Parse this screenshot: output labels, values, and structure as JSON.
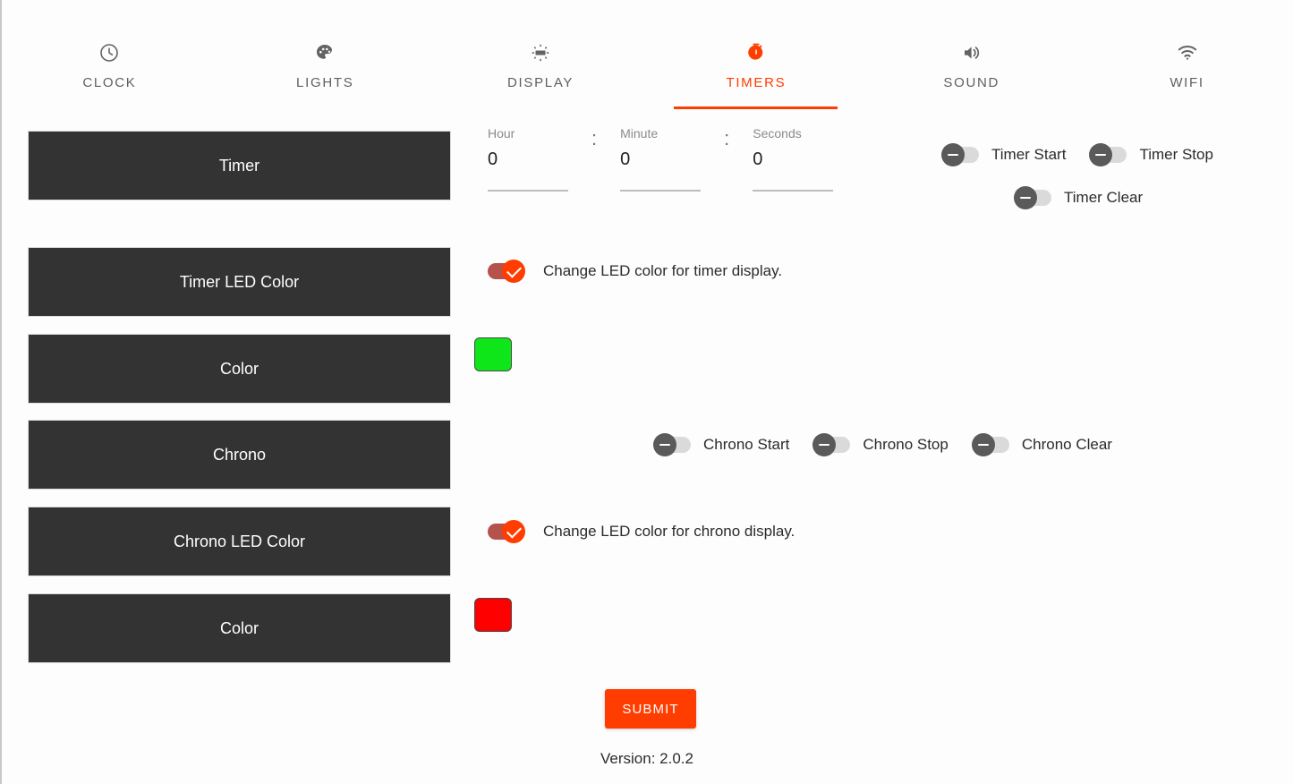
{
  "tabs": [
    {
      "label": "CLOCK",
      "icon": "clock-icon",
      "active": false
    },
    {
      "label": "LIGHTS",
      "icon": "palette-icon",
      "active": false
    },
    {
      "label": "DISPLAY",
      "icon": "brightness-icon",
      "active": false
    },
    {
      "label": "TIMERS",
      "icon": "stopwatch-icon",
      "active": true
    },
    {
      "label": "SOUND",
      "icon": "volume-icon",
      "active": false
    },
    {
      "label": "WIFI",
      "icon": "wifi-icon",
      "active": false
    }
  ],
  "panels": {
    "timer": "Timer",
    "timer_led_color": "Timer LED Color",
    "timer_color": "Color",
    "chrono": "Chrono",
    "chrono_led_color": "Chrono LED Color",
    "chrono_color": "Color"
  },
  "time_inputs": {
    "separator": ":",
    "hour": {
      "label": "Hour",
      "value": "0",
      "placeholder": "Hour"
    },
    "minute": {
      "label": "Minute",
      "value": "0",
      "placeholder": "Minute"
    },
    "seconds": {
      "label": "Seconds",
      "value": "0",
      "placeholder": "Seconds"
    }
  },
  "timer_toggles": {
    "start": {
      "label": "Timer Start",
      "state": "off"
    },
    "stop": {
      "label": "Timer Stop",
      "state": "off"
    },
    "clear": {
      "label": "Timer Clear",
      "state": "off"
    }
  },
  "chrono_toggles": {
    "start": {
      "label": "Chrono Start",
      "state": "off"
    },
    "stop": {
      "label": "Chrono Stop",
      "state": "off"
    },
    "clear": {
      "label": "Chrono Clear",
      "state": "off"
    }
  },
  "led_options": {
    "timer": {
      "text": "Change LED color for timer display.",
      "state": "on"
    },
    "chrono": {
      "text": "Change LED color for chrono display.",
      "state": "on"
    }
  },
  "colors": {
    "timer_swatch": "#0FE619",
    "chrono_swatch": "#FF0000",
    "accent": "#FF3D00",
    "panel_bg": "#333333",
    "toggle_off_knob": "#5A5A5A",
    "toggle_off_track": "#DADADA"
  },
  "submit": {
    "label": "SUBMIT"
  },
  "footer": {
    "version": "Version: 2.0.2"
  }
}
